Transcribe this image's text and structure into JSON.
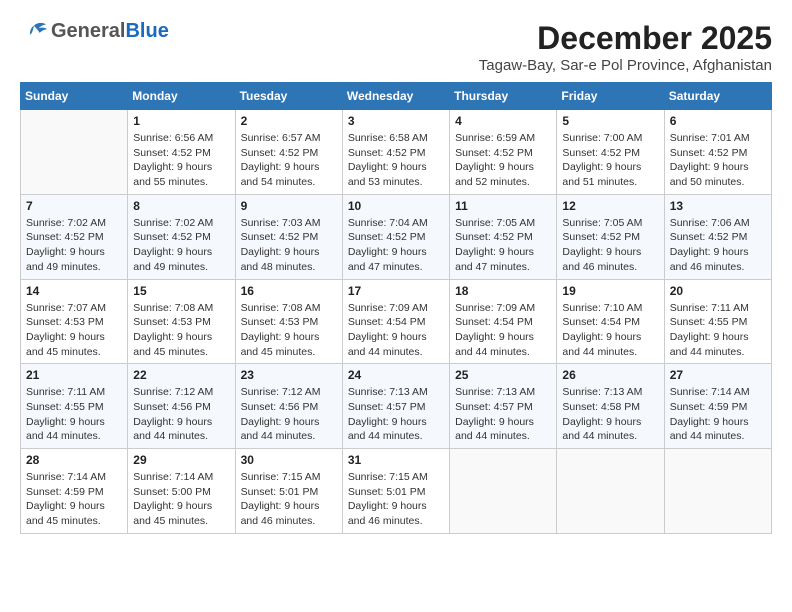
{
  "header": {
    "logo_general": "General",
    "logo_blue": "Blue",
    "month_title": "December 2025",
    "location": "Tagaw-Bay, Sar-e Pol Province, Afghanistan"
  },
  "weekdays": [
    "Sunday",
    "Monday",
    "Tuesday",
    "Wednesday",
    "Thursday",
    "Friday",
    "Saturday"
  ],
  "weeks": [
    [
      {
        "day": "",
        "info": ""
      },
      {
        "day": "1",
        "info": "Sunrise: 6:56 AM\nSunset: 4:52 PM\nDaylight: 9 hours\nand 55 minutes."
      },
      {
        "day": "2",
        "info": "Sunrise: 6:57 AM\nSunset: 4:52 PM\nDaylight: 9 hours\nand 54 minutes."
      },
      {
        "day": "3",
        "info": "Sunrise: 6:58 AM\nSunset: 4:52 PM\nDaylight: 9 hours\nand 53 minutes."
      },
      {
        "day": "4",
        "info": "Sunrise: 6:59 AM\nSunset: 4:52 PM\nDaylight: 9 hours\nand 52 minutes."
      },
      {
        "day": "5",
        "info": "Sunrise: 7:00 AM\nSunset: 4:52 PM\nDaylight: 9 hours\nand 51 minutes."
      },
      {
        "day": "6",
        "info": "Sunrise: 7:01 AM\nSunset: 4:52 PM\nDaylight: 9 hours\nand 50 minutes."
      }
    ],
    [
      {
        "day": "7",
        "info": "Sunrise: 7:02 AM\nSunset: 4:52 PM\nDaylight: 9 hours\nand 49 minutes."
      },
      {
        "day": "8",
        "info": "Sunrise: 7:02 AM\nSunset: 4:52 PM\nDaylight: 9 hours\nand 49 minutes."
      },
      {
        "day": "9",
        "info": "Sunrise: 7:03 AM\nSunset: 4:52 PM\nDaylight: 9 hours\nand 48 minutes."
      },
      {
        "day": "10",
        "info": "Sunrise: 7:04 AM\nSunset: 4:52 PM\nDaylight: 9 hours\nand 47 minutes."
      },
      {
        "day": "11",
        "info": "Sunrise: 7:05 AM\nSunset: 4:52 PM\nDaylight: 9 hours\nand 47 minutes."
      },
      {
        "day": "12",
        "info": "Sunrise: 7:05 AM\nSunset: 4:52 PM\nDaylight: 9 hours\nand 46 minutes."
      },
      {
        "day": "13",
        "info": "Sunrise: 7:06 AM\nSunset: 4:52 PM\nDaylight: 9 hours\nand 46 minutes."
      }
    ],
    [
      {
        "day": "14",
        "info": "Sunrise: 7:07 AM\nSunset: 4:53 PM\nDaylight: 9 hours\nand 45 minutes."
      },
      {
        "day": "15",
        "info": "Sunrise: 7:08 AM\nSunset: 4:53 PM\nDaylight: 9 hours\nand 45 minutes."
      },
      {
        "day": "16",
        "info": "Sunrise: 7:08 AM\nSunset: 4:53 PM\nDaylight: 9 hours\nand 45 minutes."
      },
      {
        "day": "17",
        "info": "Sunrise: 7:09 AM\nSunset: 4:54 PM\nDaylight: 9 hours\nand 44 minutes."
      },
      {
        "day": "18",
        "info": "Sunrise: 7:09 AM\nSunset: 4:54 PM\nDaylight: 9 hours\nand 44 minutes."
      },
      {
        "day": "19",
        "info": "Sunrise: 7:10 AM\nSunset: 4:54 PM\nDaylight: 9 hours\nand 44 minutes."
      },
      {
        "day": "20",
        "info": "Sunrise: 7:11 AM\nSunset: 4:55 PM\nDaylight: 9 hours\nand 44 minutes."
      }
    ],
    [
      {
        "day": "21",
        "info": "Sunrise: 7:11 AM\nSunset: 4:55 PM\nDaylight: 9 hours\nand 44 minutes."
      },
      {
        "day": "22",
        "info": "Sunrise: 7:12 AM\nSunset: 4:56 PM\nDaylight: 9 hours\nand 44 minutes."
      },
      {
        "day": "23",
        "info": "Sunrise: 7:12 AM\nSunset: 4:56 PM\nDaylight: 9 hours\nand 44 minutes."
      },
      {
        "day": "24",
        "info": "Sunrise: 7:13 AM\nSunset: 4:57 PM\nDaylight: 9 hours\nand 44 minutes."
      },
      {
        "day": "25",
        "info": "Sunrise: 7:13 AM\nSunset: 4:57 PM\nDaylight: 9 hours\nand 44 minutes."
      },
      {
        "day": "26",
        "info": "Sunrise: 7:13 AM\nSunset: 4:58 PM\nDaylight: 9 hours\nand 44 minutes."
      },
      {
        "day": "27",
        "info": "Sunrise: 7:14 AM\nSunset: 4:59 PM\nDaylight: 9 hours\nand 44 minutes."
      }
    ],
    [
      {
        "day": "28",
        "info": "Sunrise: 7:14 AM\nSunset: 4:59 PM\nDaylight: 9 hours\nand 45 minutes."
      },
      {
        "day": "29",
        "info": "Sunrise: 7:14 AM\nSunset: 5:00 PM\nDaylight: 9 hours\nand 45 minutes."
      },
      {
        "day": "30",
        "info": "Sunrise: 7:15 AM\nSunset: 5:01 PM\nDaylight: 9 hours\nand 46 minutes."
      },
      {
        "day": "31",
        "info": "Sunrise: 7:15 AM\nSunset: 5:01 PM\nDaylight: 9 hours\nand 46 minutes."
      },
      {
        "day": "",
        "info": ""
      },
      {
        "day": "",
        "info": ""
      },
      {
        "day": "",
        "info": ""
      }
    ]
  ]
}
